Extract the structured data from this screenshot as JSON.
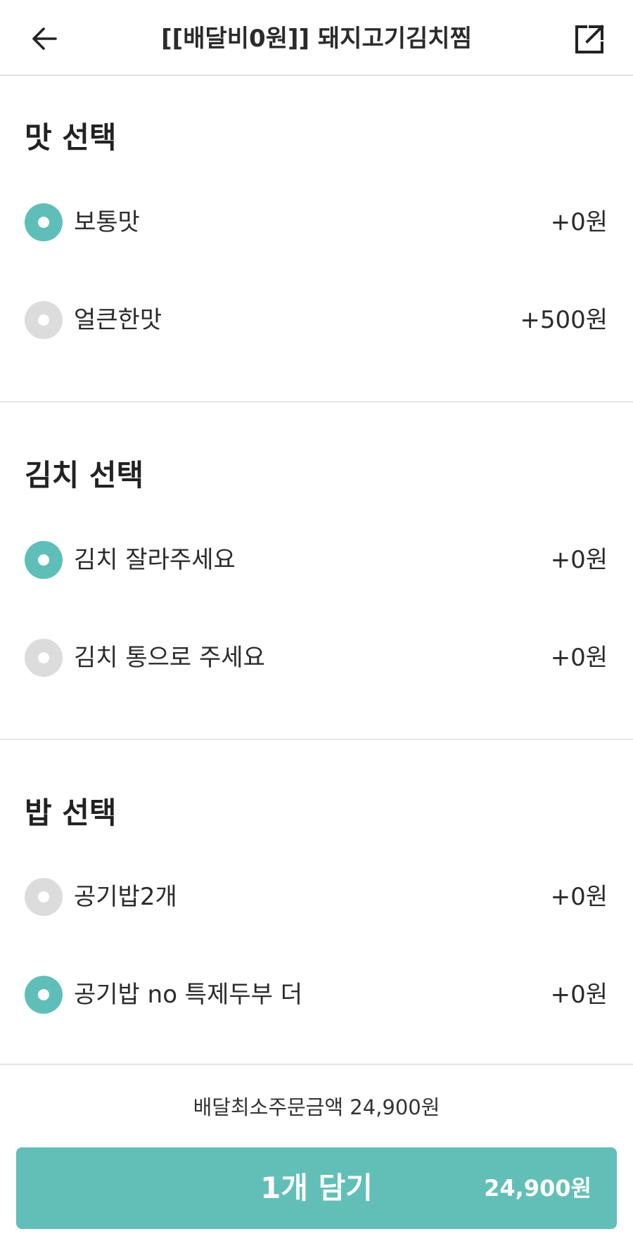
{
  "header": {
    "title": "[[배달비0원]] 돼지고기김치찜",
    "back_icon": "arrow-left-icon",
    "share_icon": "share-external-icon"
  },
  "sections": [
    {
      "title": "맛 선택",
      "options": [
        {
          "label": "보통맛",
          "price": "+0원",
          "selected": true
        },
        {
          "label": "얼큰한맛",
          "price": "+500원",
          "selected": false
        }
      ]
    },
    {
      "title": "김치 선택",
      "options": [
        {
          "label": "김치 잘라주세요",
          "price": "+0원",
          "selected": true
        },
        {
          "label": "김치 통으로 주세요",
          "price": "+0원",
          "selected": false
        }
      ]
    },
    {
      "title": "밥 선택",
      "options": [
        {
          "label": "공기밥2개",
          "price": "+0원",
          "selected": false
        },
        {
          "label": "공기밥 no 특제두부 더",
          "price": "+0원",
          "selected": true
        }
      ]
    }
  ],
  "footer": {
    "min_order_note": "배달최소주문금액 24,900원",
    "cart_label": "1개 담기",
    "cart_price": "24,900원"
  },
  "colors": {
    "accent": "#5fbfb8",
    "radio_off": "#dcdcdc",
    "divider": "#e6e6e6"
  }
}
